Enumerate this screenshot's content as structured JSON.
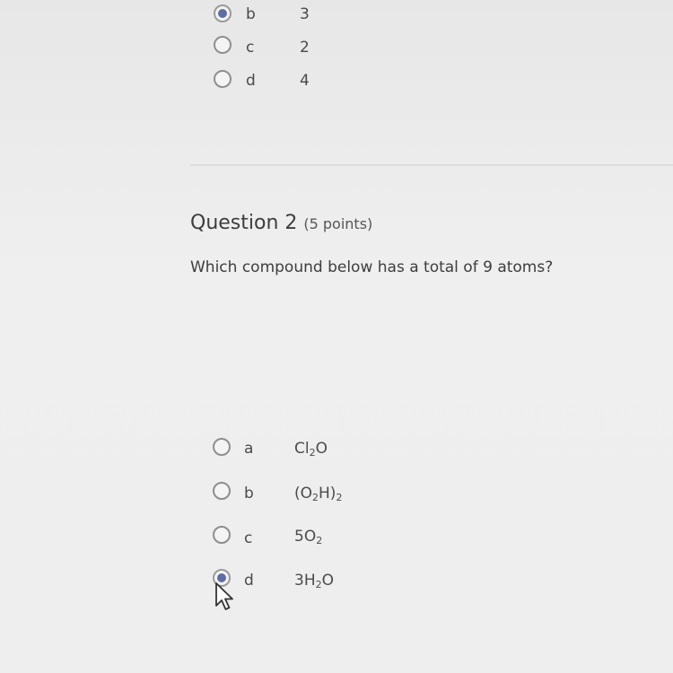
{
  "question1": {
    "options": [
      {
        "letter": "b",
        "value": "3",
        "selected": true
      },
      {
        "letter": "c",
        "value": "2",
        "selected": false
      },
      {
        "letter": "d",
        "value": "4",
        "selected": false
      }
    ]
  },
  "question2": {
    "title": "Question 2",
    "points": "(5 points)",
    "prompt": "Which compound below has a total of 9 atoms?",
    "options": [
      {
        "letter": "a",
        "selected": false,
        "formula": {
          "p1": "Cl",
          "s1": "2",
          "p2": "O",
          "s2": "",
          "p3": ""
        }
      },
      {
        "letter": "b",
        "selected": false,
        "formula": {
          "p1": "(O",
          "s1": "2",
          "p2": "H)",
          "s2": "2",
          "p3": ""
        }
      },
      {
        "letter": "c",
        "selected": false,
        "formula": {
          "p1": "5O",
          "s1": "2",
          "p2": "",
          "s2": "",
          "p3": ""
        }
      },
      {
        "letter": "d",
        "selected": true,
        "formula": {
          "p1": "3H",
          "s1": "2",
          "p2": "O",
          "s2": "",
          "p3": ""
        }
      }
    ]
  },
  "colors": {
    "radio_selected": "#5e6da3",
    "radio_border": "#8e8e8e",
    "background": "#eeeeee"
  },
  "icons": {
    "cursor": "mouse-pointer-icon"
  }
}
